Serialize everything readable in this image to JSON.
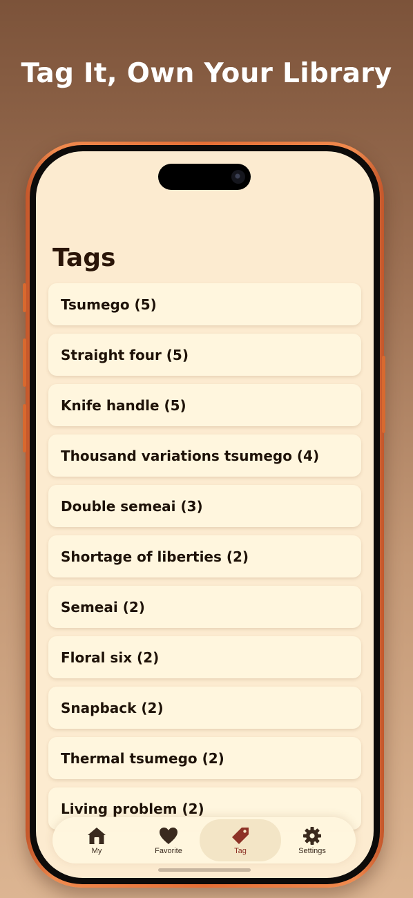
{
  "headline": "Tag It, Own Your Library",
  "screen": {
    "title": "Tags",
    "tags": [
      {
        "label": "Tsumego (5)"
      },
      {
        "label": "Straight four (5)"
      },
      {
        "label": "Knife handle (5)"
      },
      {
        "label": "Thousand variations tsumego (4)"
      },
      {
        "label": "Double semeai (3)"
      },
      {
        "label": "Shortage of liberties (2)"
      },
      {
        "label": "Semeai (2)"
      },
      {
        "label": "Floral six (2)"
      },
      {
        "label": "Snapback (2)"
      },
      {
        "label": "Thermal tsumego (2)"
      },
      {
        "label": "Living problem (2)"
      }
    ],
    "tab_bar": {
      "active": "Tag",
      "tabs": [
        {
          "label": "My",
          "icon": "house-icon"
        },
        {
          "label": "Favorite",
          "icon": "heart-icon"
        },
        {
          "label": "Tag",
          "icon": "tag-icon"
        },
        {
          "label": "Settings",
          "icon": "gear-icon"
        }
      ]
    }
  },
  "colors": {
    "background_top": "#7c533a",
    "background_bottom": "#dcb592",
    "phone_frame": "#e56f36",
    "screen_background": "#fcebd0",
    "row_background": "#fff6de",
    "active_tab_accent": "#8d3227"
  }
}
